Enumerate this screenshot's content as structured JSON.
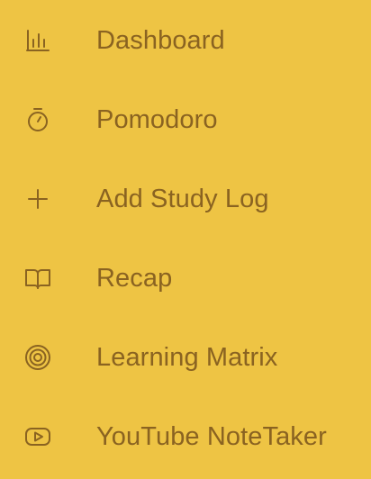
{
  "sidebar": {
    "accent_color": "#8a6321",
    "background_color": "#eec444",
    "items": [
      {
        "label": "Dashboard",
        "icon": "bar-chart-icon"
      },
      {
        "label": "Pomodoro",
        "icon": "timer-icon"
      },
      {
        "label": "Add Study Log",
        "icon": "plus-icon"
      },
      {
        "label": "Recap",
        "icon": "book-open-icon"
      },
      {
        "label": "Learning Matrix",
        "icon": "target-icon"
      },
      {
        "label": "YouTube NoteTaker",
        "icon": "youtube-icon"
      }
    ]
  }
}
